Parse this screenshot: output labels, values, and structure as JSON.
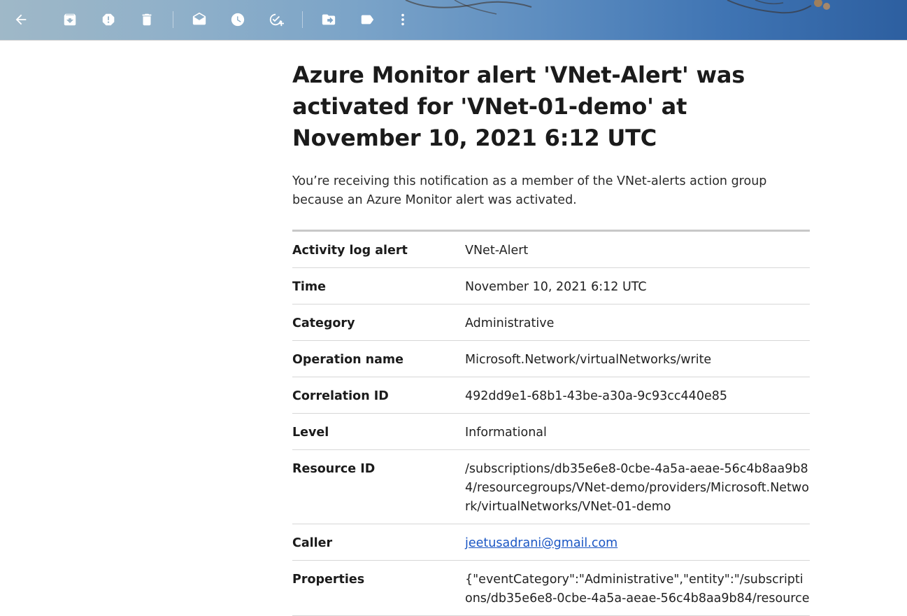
{
  "toolbar": {
    "buttons": [
      {
        "name": "back",
        "icon": "arrow-left-icon"
      },
      {
        "name": "archive",
        "icon": "archive-icon"
      },
      {
        "name": "report-spam",
        "icon": "report-spam-icon"
      },
      {
        "name": "delete",
        "icon": "trash-icon"
      },
      {
        "name": "mark-unread",
        "icon": "mail-open-icon"
      },
      {
        "name": "snooze",
        "icon": "clock-icon"
      },
      {
        "name": "add-to-tasks",
        "icon": "add-task-icon"
      },
      {
        "name": "move-to",
        "icon": "move-to-folder-icon"
      },
      {
        "name": "labels",
        "icon": "label-icon"
      },
      {
        "name": "more",
        "icon": "more-vertical-icon"
      }
    ],
    "icon_color": "#ffffff"
  },
  "email": {
    "subject": "Azure Monitor alert 'VNet-Alert' was activated for 'VNet-01-demo' at November 10, 2021 6:12 UTC",
    "intro": "You’re receiving this notification as a member of the VNet-alerts action group because an Azure Monitor alert was activated.",
    "details": [
      {
        "label": "Activity log alert",
        "value": "VNet-Alert"
      },
      {
        "label": "Time",
        "value": "November 10, 2021 6:12 UTC"
      },
      {
        "label": "Category",
        "value": "Administrative"
      },
      {
        "label": "Operation name",
        "value": "Microsoft.Network/virtualNetworks/write"
      },
      {
        "label": "Correlation ID",
        "value": "492dd9e1-68b1-43be-a30a-9c93cc440e85"
      },
      {
        "label": "Level",
        "value": "Informational"
      },
      {
        "label": "Resource ID",
        "value": "/subscriptions/db35e6e8-0cbe-4a5a-aeae-56c4b8aa9b84/resourcegroups/VNet-demo/providers/Microsoft.Network/virtualNetworks/VNet-01-demo"
      },
      {
        "label": "Caller",
        "value": "jeetusadrani@gmail.com"
      },
      {
        "label": "Properties",
        "value": "{\"eventCategory\":\"Administrative\",\"entity\":\"/subscriptions/db35e6e8-0cbe-4a5a-aeae-56c4b8aa9b84/resource"
      }
    ],
    "link_color": "#1a56c4"
  }
}
